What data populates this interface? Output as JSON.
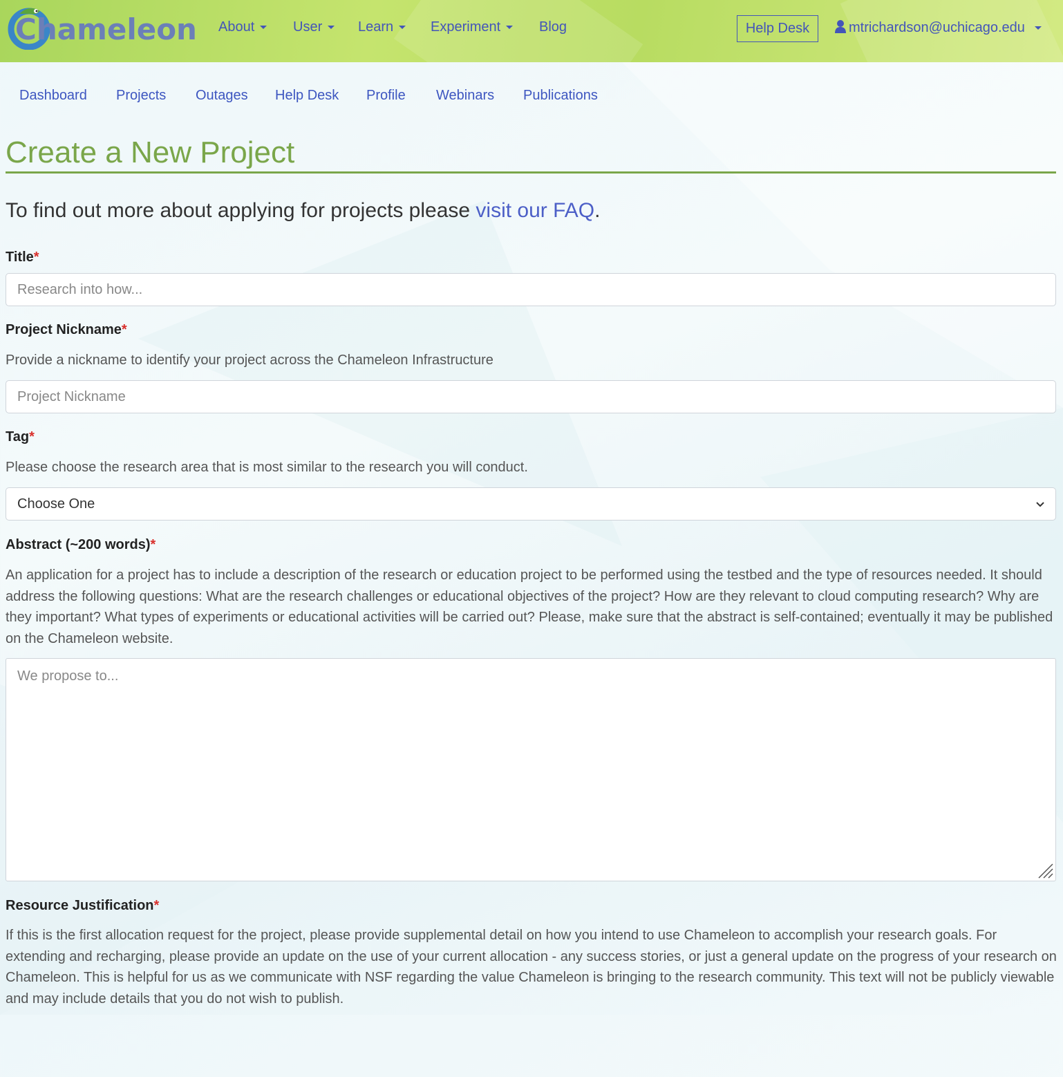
{
  "brand": {
    "name": "Chameleon"
  },
  "topnav": {
    "items": [
      {
        "label": "About",
        "dropdown": true
      },
      {
        "label": "User",
        "dropdown": true
      },
      {
        "label": "Learn",
        "dropdown": true
      },
      {
        "label": "Experiment",
        "dropdown": true
      },
      {
        "label": "Blog",
        "dropdown": false
      }
    ],
    "helpdesk_label": "Help Desk",
    "user_email": "mtrichardson@uchicago.edu"
  },
  "subnav": {
    "items": [
      "Dashboard",
      "Projects",
      "Outages",
      "Help Desk",
      "Profile",
      "Webinars",
      "Publications"
    ]
  },
  "page": {
    "title": "Create a New Project",
    "intro_prefix": "To find out more about applying for projects please ",
    "intro_link": "visit our FAQ",
    "intro_suffix": "."
  },
  "form": {
    "required_marker": "*",
    "title": {
      "label": "Title",
      "placeholder": "Research into how..."
    },
    "nickname": {
      "label": "Project Nickname",
      "help": "Provide a nickname to identify your project across the Chameleon Infrastructure",
      "placeholder": "Project Nickname"
    },
    "tag": {
      "label": "Tag",
      "help": "Please choose the research area that is most similar to the research you will conduct.",
      "selected": "Choose One"
    },
    "abstract": {
      "label": "Abstract (~200 words)",
      "help": "An application for a project has to include a description of the research or education project to be performed using the testbed and the type of resources needed. It should address the following questions: What are the research challenges or educational objectives of the project? How are they relevant to cloud computing research? Why are they important? What types of experiments or educational activities will be carried out? Please, make sure that the abstract is self-contained; eventually it may be published on the Chameleon website.",
      "placeholder": "We propose to..."
    },
    "justification": {
      "label": "Resource Justification",
      "help": "If this is the first allocation request for the project, please provide supplemental detail on how you intend to use Chameleon to accomplish your research goals. For extending and recharging, please provide an update on the use of your current allocation - any success stories, or just a general update on the progress of your research on Chameleon. This is helpful for us as we communicate with NSF regarding the value Chameleon is bringing to the research community. This text will not be publicly viewable and may include details that you do not wish to publish."
    }
  },
  "colors": {
    "nav_link": "#4355b9",
    "title_green": "#7aa64a",
    "required_red": "#d9302c",
    "topbar_green": "#b8dc61"
  }
}
